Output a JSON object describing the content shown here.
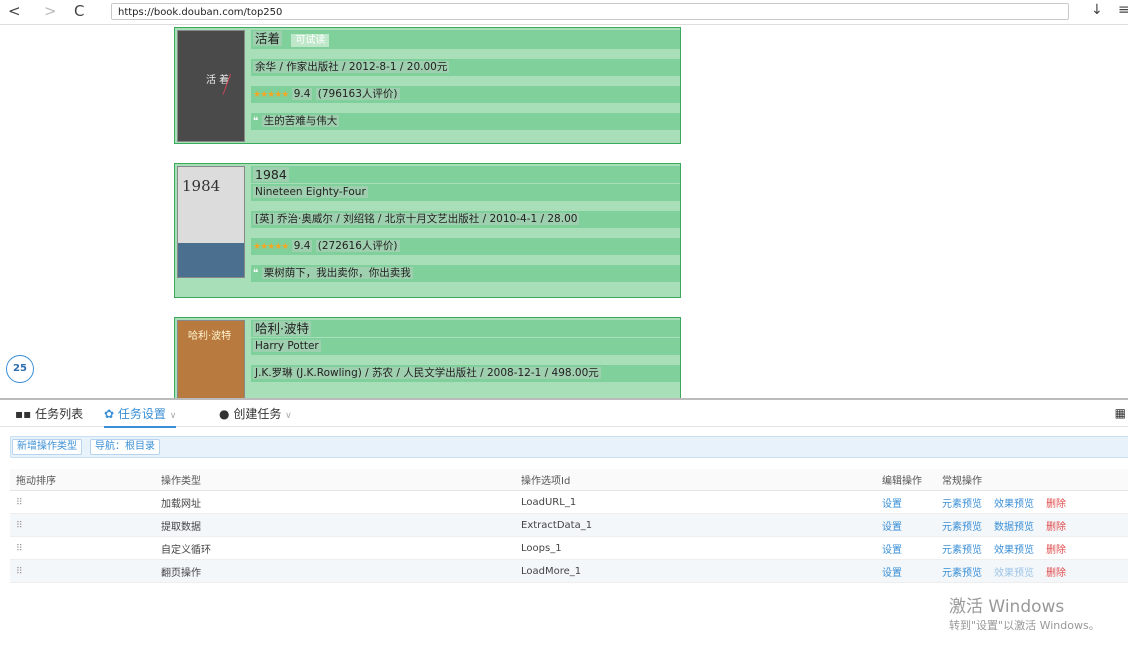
{
  "browser": {
    "back": "<",
    "forward": ">",
    "reload": "C",
    "url": "https://book.douban.com/top250",
    "download_icon": "↓",
    "menu_icon": "≡"
  },
  "books": [
    {
      "title": "活着",
      "tag": "可试读",
      "subtitle": "",
      "meta": "余华 / 作家出版社 / 2012-8-1 / 20.00元",
      "rating": "9.4",
      "ratings_count": "(796163人评价)",
      "quote": "生的苦难与伟大",
      "cover_title": "活 着",
      "cover_color": "#4a4a4a"
    },
    {
      "title": "1984",
      "tag": "",
      "subtitle": "Nineteen Eighty-Four",
      "meta": "[英] 乔治·奥威尔 / 刘绍铭 / 北京十月文艺出版社 / 2010-4-1 / 28.00",
      "rating": "9.4",
      "ratings_count": "(272616人评价)",
      "quote": "栗树荫下，我出卖你，你出卖我",
      "cover_title": "1984",
      "cover_color": "#d8d8d8"
    },
    {
      "title": "哈利·波特",
      "tag": "",
      "subtitle": "Harry Potter",
      "meta": "J.K.罗琳 (J.K.Rowling) / 苏农 / 人民文学出版社 / 2008-12-1 / 498.00元",
      "cover_title": "哈利·波特",
      "cover_color": "#b87a3e"
    }
  ],
  "badge_count": "25",
  "panel": {
    "tabs": [
      {
        "label": "任务列表",
        "icon": "grid"
      },
      {
        "label": "任务设置",
        "icon": "gear"
      },
      {
        "label": "创建任务",
        "icon": "plus-circle"
      }
    ],
    "add_op_type_button": "新增操作类型",
    "breadcrumb": "导航：根目录",
    "columns": [
      "拖动排序",
      "操作类型",
      "操作选项Id",
      "编辑操作",
      "常规操作"
    ],
    "rows": [
      {
        "type": "加载网址",
        "id": "LoadURL_1",
        "edit": "设置",
        "a1": "元素预览",
        "a2": "效果预览",
        "del": "删除",
        "a2_dim": false
      },
      {
        "type": "提取数据",
        "id": "ExtractData_1",
        "edit": "设置",
        "a1": "元素预览",
        "a2": "数据预览",
        "del": "删除",
        "a2_dim": false
      },
      {
        "type": "自定义循环",
        "id": "Loops_1",
        "edit": "设置",
        "a1": "元素预览",
        "a2": "效果预览",
        "del": "删除",
        "a2_dim": false
      },
      {
        "type": "翻页操作",
        "id": "LoadMore_1",
        "edit": "设置",
        "a1": "元素预览",
        "a2": "效果预览",
        "del": "删除",
        "a2_dim": true
      }
    ]
  },
  "watermark": {
    "line1": "激活 Windows",
    "line2": "转到\"设置\"以激活 Windows。"
  }
}
